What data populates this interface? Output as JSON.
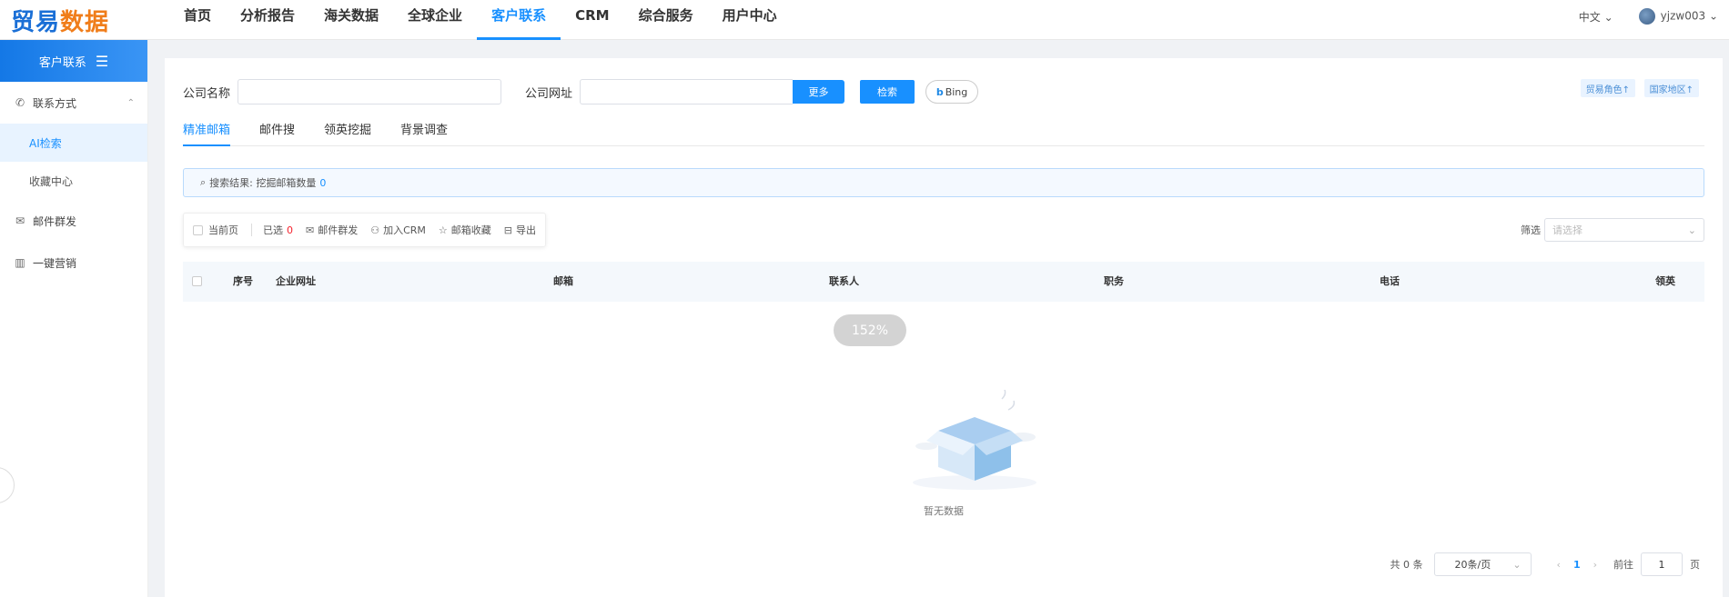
{
  "logo": {
    "part1": "贸易",
    "part2": "数据"
  },
  "nav": [
    {
      "label": "首页"
    },
    {
      "label": "分析报告"
    },
    {
      "label": "海关数据"
    },
    {
      "label": "全球企业"
    },
    {
      "label": "客户联系"
    },
    {
      "label": "CRM"
    },
    {
      "label": "综合服务"
    },
    {
      "label": "用户中心"
    }
  ],
  "header": {
    "language": "中文",
    "username": "yjzw003"
  },
  "sidebar": {
    "title": "客户联系",
    "contact_group": "联系方式",
    "sub_items": [
      {
        "label": "AI检索"
      },
      {
        "label": "收藏中心"
      }
    ],
    "email_blast": "邮件群发",
    "marketing": "一键营销"
  },
  "search": {
    "company_name_label": "公司名称",
    "company_name_value": "",
    "company_site_label": "公司网址",
    "company_site_value": "",
    "more_button": "更多",
    "search_button": "检索",
    "bing_label": "Bing",
    "trade_role": "贸易角色↑",
    "country_region": "国家地区↑"
  },
  "tabs": [
    {
      "label": "精准邮箱"
    },
    {
      "label": "邮件搜"
    },
    {
      "label": "领英挖掘"
    },
    {
      "label": "背景调查"
    }
  ],
  "result": {
    "label": "搜索结果: 挖掘邮箱数量",
    "count": "0"
  },
  "toolbar": {
    "current_page": "当前页",
    "selected": "已选",
    "selected_count": "0",
    "email_blast": "邮件群发",
    "add_crm": "加入CRM",
    "email_fav": "邮箱收藏",
    "export": "导出"
  },
  "filter": {
    "label": "筛选",
    "placeholder": "请选择"
  },
  "table": {
    "columns": [
      "序号",
      "企业网址",
      "邮箱",
      "联系人",
      "职务",
      "电话",
      "领英"
    ],
    "rows": []
  },
  "zoom": "152%",
  "empty_text": "暂无数据",
  "pagination": {
    "total": "共 0 条",
    "page_size": "20条/页",
    "current": "1",
    "goto_label": "前往",
    "goto_value": "1",
    "page_suffix": "页"
  },
  "colors": {
    "accent": "#1890ff",
    "logo_blue": "#1a6fd6",
    "logo_orange": "#f07d1a",
    "danger": "#f5222d"
  }
}
